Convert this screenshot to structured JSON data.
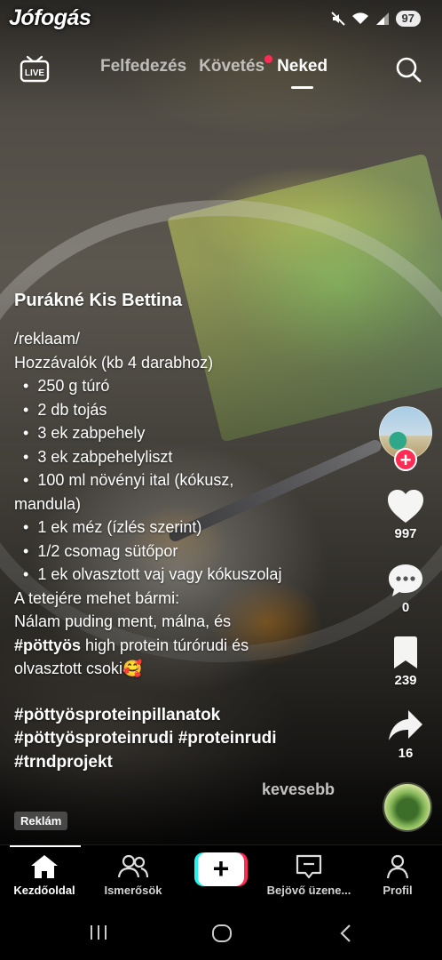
{
  "watermark": "Jófogás",
  "status_bar": {
    "battery": "97",
    "icons": [
      "mute-icon",
      "wifi-icon",
      "signal-icon"
    ]
  },
  "top_nav": {
    "live_label": "LIVE",
    "tabs": [
      {
        "label": "Felfedezés",
        "active": false
      },
      {
        "label": "Követés",
        "active": false,
        "has_dot": true
      },
      {
        "label": "Neked",
        "active": true
      }
    ]
  },
  "post": {
    "author": "Purákné Kis Bettina",
    "caption": {
      "line1": "/reklaam/",
      "line2": "Hozzávalók (kb 4 darabhoz)",
      "ingredients": [
        "250 g túró",
        "2 db tojás",
        "3 ek zabpehely",
        "3 ek zabpehelyliszt",
        "100 ml növényi ital (kókusz,",
        "1 ek méz (ízlés szerint)",
        "1/2 csomag sütőpor",
        "1 ek olvasztott vaj vagy kókuszolaj"
      ],
      "ingredient_wrap": "mandula)",
      "topping_1": "A tetejére mehet bármi:",
      "topping_2": "Nálam puding ment, málna, és",
      "topping_3_bold": "#pöttyös",
      "topping_3_rest": " high protein túrórudi és",
      "topping_4": "olvasztott csoki🥰",
      "hashtags": [
        "#pöttyösproteinpillanatok",
        "#pöttyösproteinrudi #proteinrudi",
        "#trndprojekt"
      ]
    },
    "less_label": "kevesebb",
    "ad_badge": "Reklám"
  },
  "actions": {
    "likes": "997",
    "comments": "0",
    "bookmarks": "239",
    "shares": "16"
  },
  "bottom_nav": [
    {
      "label": "Kezdőoldal",
      "icon": "home-icon",
      "active": true
    },
    {
      "label": "Ismerősök",
      "icon": "friends-icon"
    },
    {
      "label": "",
      "icon": "plus-icon"
    },
    {
      "label": "Bejövő üzene...",
      "icon": "inbox-icon"
    },
    {
      "label": "Profil",
      "icon": "profile-icon"
    }
  ],
  "colors": {
    "accent": "#fe2c55",
    "cyan": "#25f4ee"
  }
}
